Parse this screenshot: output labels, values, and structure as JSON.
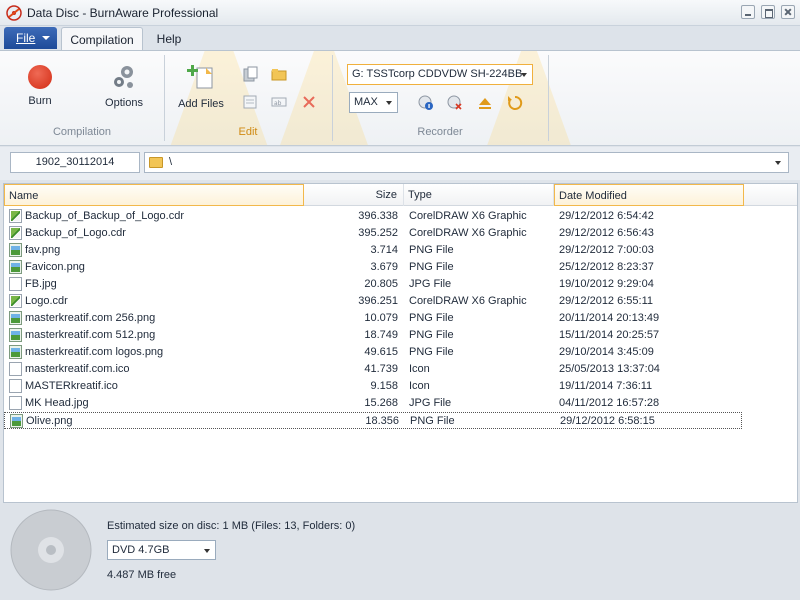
{
  "window": {
    "title": "Data Disc - BurnAware Professional"
  },
  "ribbon_tabs": {
    "file": "File",
    "compilation": "Compilation",
    "help": "Help"
  },
  "groups": {
    "compilation": {
      "label": "Compilation",
      "burn": "Burn",
      "options": "Options"
    },
    "edit": {
      "label": "Edit",
      "add_files": "Add Files"
    },
    "recorder": {
      "label": "Recorder",
      "drive": "G: TSSTcorp CDDVDW SH-224BB",
      "speed": "MAX"
    }
  },
  "pathbar": {
    "volume_label": "1902_30112014",
    "path": "\\"
  },
  "columns": {
    "name": "Name",
    "size": "Size",
    "type": "Type",
    "date": "Date Modified"
  },
  "files": [
    {
      "name": "Backup_of_Backup_of_Logo.cdr",
      "size": "396.338",
      "type": "CorelDRAW X6 Graphic",
      "date": "29/12/2012 6:54:42",
      "icon": "cdr"
    },
    {
      "name": "Backup_of_Logo.cdr",
      "size": "395.252",
      "type": "CorelDRAW X6 Graphic",
      "date": "29/12/2012 6:56:43",
      "icon": "cdr"
    },
    {
      "name": "fav.png",
      "size": "3.714",
      "type": "PNG File",
      "date": "29/12/2012 7:00:03",
      "icon": "png"
    },
    {
      "name": "Favicon.png",
      "size": "3.679",
      "type": "PNG File",
      "date": "25/12/2012 8:23:37",
      "icon": "png"
    },
    {
      "name": "FB.jpg",
      "size": "20.805",
      "type": "JPG File",
      "date": "19/10/2012 9:29:04",
      "icon": "blank"
    },
    {
      "name": "Logo.cdr",
      "size": "396.251",
      "type": "CorelDRAW X6 Graphic",
      "date": "29/12/2012 6:55:11",
      "icon": "cdr"
    },
    {
      "name": "masterkreatif.com 256.png",
      "size": "10.079",
      "type": "PNG File",
      "date": "20/11/2014 20:13:49",
      "icon": "png"
    },
    {
      "name": "masterkreatif.com 512.png",
      "size": "18.749",
      "type": "PNG File",
      "date": "15/11/2014 20:25:57",
      "icon": "png"
    },
    {
      "name": "masterkreatif.com logos.png",
      "size": "49.615",
      "type": "PNG File",
      "date": "29/10/2014 3:45:09",
      "icon": "png"
    },
    {
      "name": "masterkreatif.com.ico",
      "size": "41.739",
      "type": "Icon",
      "date": "25/05/2013 13:37:04",
      "icon": "blank"
    },
    {
      "name": "MASTERkreatif.ico",
      "size": "9.158",
      "type": "Icon",
      "date": "19/11/2014 7:36:11",
      "icon": "blank"
    },
    {
      "name": "MK Head.jpg",
      "size": "15.268",
      "type": "JPG File",
      "date": "04/11/2012 16:57:28",
      "icon": "blank"
    },
    {
      "name": "Olive.png",
      "size": "18.356",
      "type": "PNG File",
      "date": "29/12/2012 6:58:15",
      "icon": "png"
    }
  ],
  "status": {
    "estimated": "Estimated size on disc: 1 MB (Files: 13, Folders: 0)",
    "disc_type": "DVD 4.7GB",
    "free": "4.487 MB free"
  },
  "colors": {
    "accent_orange": "#f2b84b",
    "file_tab_blue": "#1e4b99",
    "burn_red": "#d22b14"
  }
}
